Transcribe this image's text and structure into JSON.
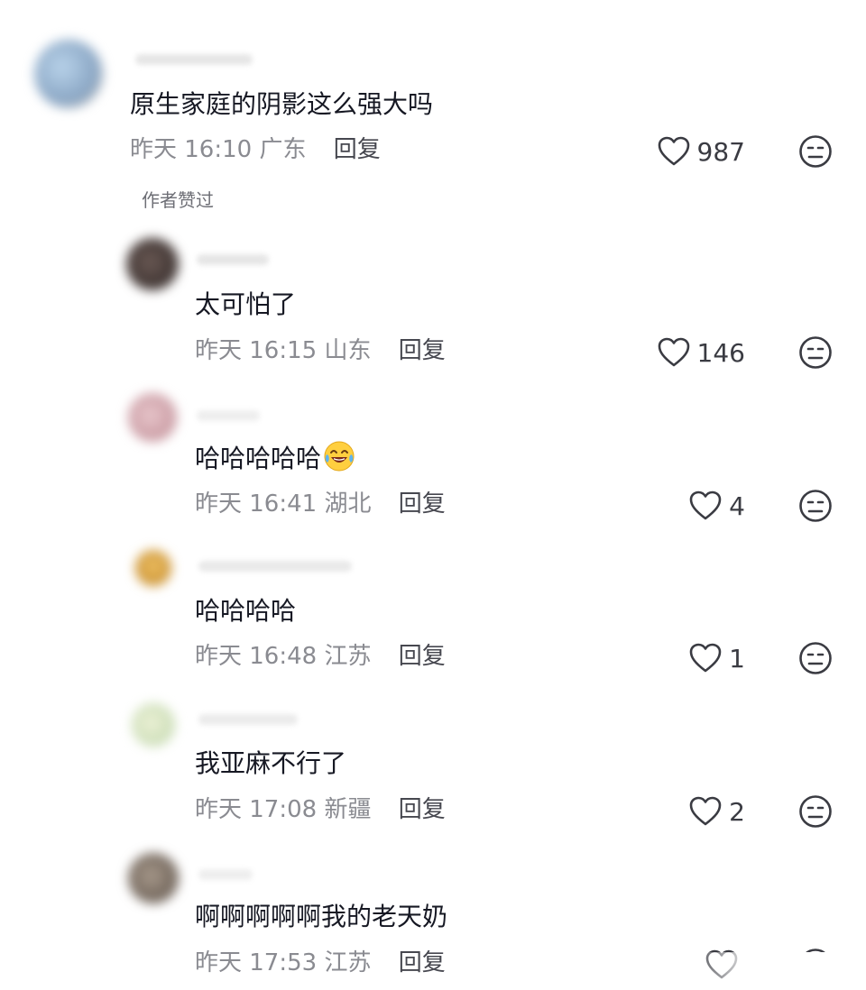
{
  "comments": [
    {
      "text": "原生家庭的阴影这么强大吗",
      "time": "昨天 16:10",
      "location": "广东",
      "reply_label": "回复",
      "likes": "987",
      "badge": "作者赞过"
    },
    {
      "text": "太可怕了",
      "time": "昨天 16:15",
      "location": "山东",
      "reply_label": "回复",
      "likes": "146"
    },
    {
      "text": "哈哈哈哈哈",
      "emoji": "laughing-tears-emoji",
      "time": "昨天 16:41",
      "location": "湖北",
      "reply_label": "回复",
      "likes": "4"
    },
    {
      "text": "哈哈哈哈",
      "time": "昨天 16:48",
      "location": "江苏",
      "reply_label": "回复",
      "likes": "1"
    },
    {
      "text": "我亚麻不行了",
      "time": "昨天 17:08",
      "location": "新疆",
      "reply_label": "回复",
      "likes": "2"
    },
    {
      "text": "啊啊啊啊啊我的老天奶",
      "time": "昨天 17:53",
      "location": "江苏",
      "reply_label": "回复",
      "likes": ""
    }
  ],
  "icons": {
    "like": "heart-outline-icon",
    "dislike": "neutral-face-icon"
  },
  "colors": {
    "text": "#161823",
    "meta": "#8a8b91",
    "icon": "#3a3b42"
  }
}
